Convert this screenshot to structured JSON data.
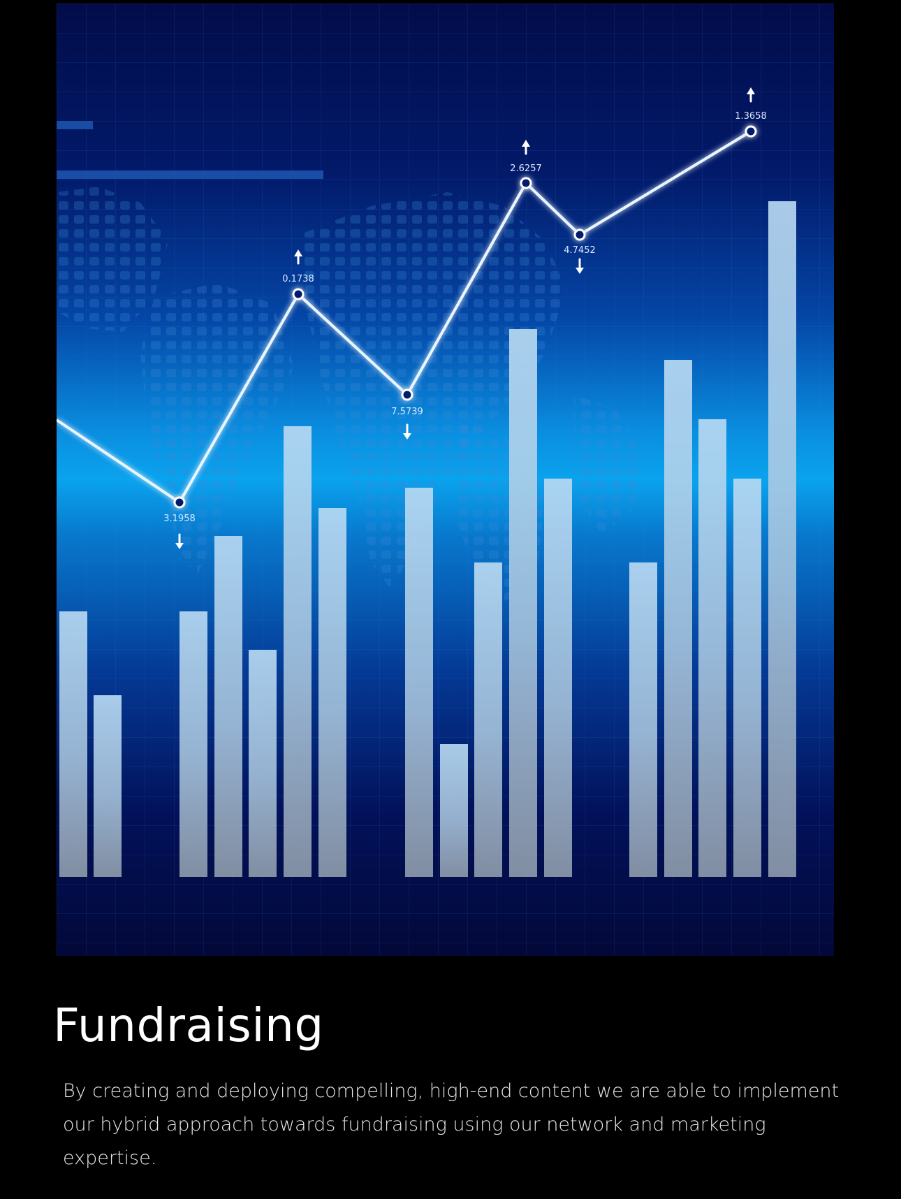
{
  "hero": {
    "annotations": [
      {
        "label": "3.1958",
        "direction": "down"
      },
      {
        "label": "0.1738",
        "direction": "up"
      },
      {
        "label": "7.5739",
        "direction": "down"
      },
      {
        "label": "2.6257",
        "direction": "up"
      },
      {
        "label": "4.7452",
        "direction": "down"
      },
      {
        "label": "1.3658",
        "direction": "up"
      }
    ]
  },
  "section": {
    "title": "Fundraising",
    "description": "By creating and deploying compelling, high-end content we are able to implement our hybrid approach towards fundraising using our network and marketing expertise."
  },
  "colors": {
    "background": "#000000",
    "accent_blue": "#0a8ee0",
    "deep_navy": "#02083a",
    "bar": "#9fc2dd",
    "text": "#ffffff"
  }
}
